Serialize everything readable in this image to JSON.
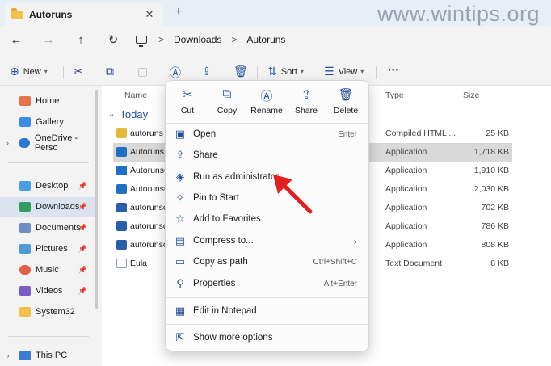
{
  "tab": {
    "title": "Autoruns",
    "close": "✕",
    "new_tab": "+"
  },
  "watermark": "www.wintips.org",
  "nav": {
    "back": "←",
    "forward": "→",
    "up": "↑",
    "refresh": "↻"
  },
  "breadcrumb": [
    "Downloads",
    "Autoruns"
  ],
  "breadcrumb_sep": ">",
  "toolbar": {
    "new": "New",
    "sort": "Sort",
    "view": "View",
    "more": "···"
  },
  "sidebar": {
    "items": [
      {
        "label": "Home",
        "color": "#e8734a"
      },
      {
        "label": "Gallery",
        "color": "#3a8ee6"
      },
      {
        "label": "OneDrive - Perso",
        "color": "#2b78d4"
      },
      {
        "label": "Desktop",
        "color": "#4a9fe0"
      },
      {
        "label": "Downloads",
        "color": "#2f9e5e"
      },
      {
        "label": "Documents",
        "color": "#6b8fc4"
      },
      {
        "label": "Pictures",
        "color": "#4f9ad8"
      },
      {
        "label": "Music",
        "color": "#e0604a"
      },
      {
        "label": "Videos",
        "color": "#7a5cc8"
      },
      {
        "label": "System32",
        "color": "#f2c14e"
      },
      {
        "label": "This PC",
        "color": "#3a7bd5"
      }
    ]
  },
  "columns": {
    "name": "Name",
    "type": "Type",
    "size": "Size"
  },
  "group_label": "Today",
  "files": [
    {
      "name": "autoruns",
      "type": "Compiled HTML ...",
      "size": "25 KB",
      "color": "#e8b83a"
    },
    {
      "name": "Autoruns",
      "type": "Application",
      "size": "1,718 KB",
      "color": "#1f6fc2",
      "selected": true
    },
    {
      "name": "Autoruns6",
      "type": "Application",
      "size": "1,910 KB",
      "color": "#1f6fc2"
    },
    {
      "name": "Autoruns6",
      "type": "Application",
      "size": "2,030 KB",
      "color": "#1f6fc2"
    },
    {
      "name": "autorunsc",
      "type": "Application",
      "size": "702 KB",
      "color": "#2a5ea8"
    },
    {
      "name": "autorunsc",
      "type": "Application",
      "size": "786 KB",
      "color": "#2a5ea8"
    },
    {
      "name": "autorunsc",
      "type": "Application",
      "size": "808 KB",
      "color": "#2a5ea8"
    },
    {
      "name": "Eula",
      "type": "Text Document",
      "size": "8 KB",
      "color": "#8a9bb0"
    }
  ],
  "context_menu": {
    "quick_actions": [
      {
        "label": "Cut",
        "icon": "✂"
      },
      {
        "label": "Copy",
        "icon": "⧉"
      },
      {
        "label": "Rename",
        "icon": "A⃞"
      },
      {
        "label": "Share",
        "icon": "⇪"
      },
      {
        "label": "Delete",
        "icon": "🗑"
      }
    ],
    "items": [
      {
        "label": "Open",
        "key": "Enter",
        "icon": "▣"
      },
      {
        "label": "Share",
        "key": "",
        "icon": "⇪"
      },
      {
        "label": "Run as administrator",
        "key": "",
        "icon": "◈"
      },
      {
        "label": "Pin to Start",
        "key": "",
        "icon": "✧"
      },
      {
        "label": "Add to Favorites",
        "key": "",
        "icon": "☆"
      },
      {
        "label": "Compress to...",
        "key": "",
        "icon": "▤",
        "submenu": "›"
      },
      {
        "label": "Copy as path",
        "key": "Ctrl+Shift+C",
        "icon": "▭"
      },
      {
        "label": "Properties",
        "key": "Alt+Enter",
        "icon": "⚲"
      },
      {
        "label": "Edit in Notepad",
        "key": "",
        "icon": "▦"
      },
      {
        "label": "Show more options",
        "key": "",
        "icon": "⇱"
      }
    ]
  },
  "colors": {
    "accent": "#1f4e9a",
    "arrow": "#e02020"
  }
}
